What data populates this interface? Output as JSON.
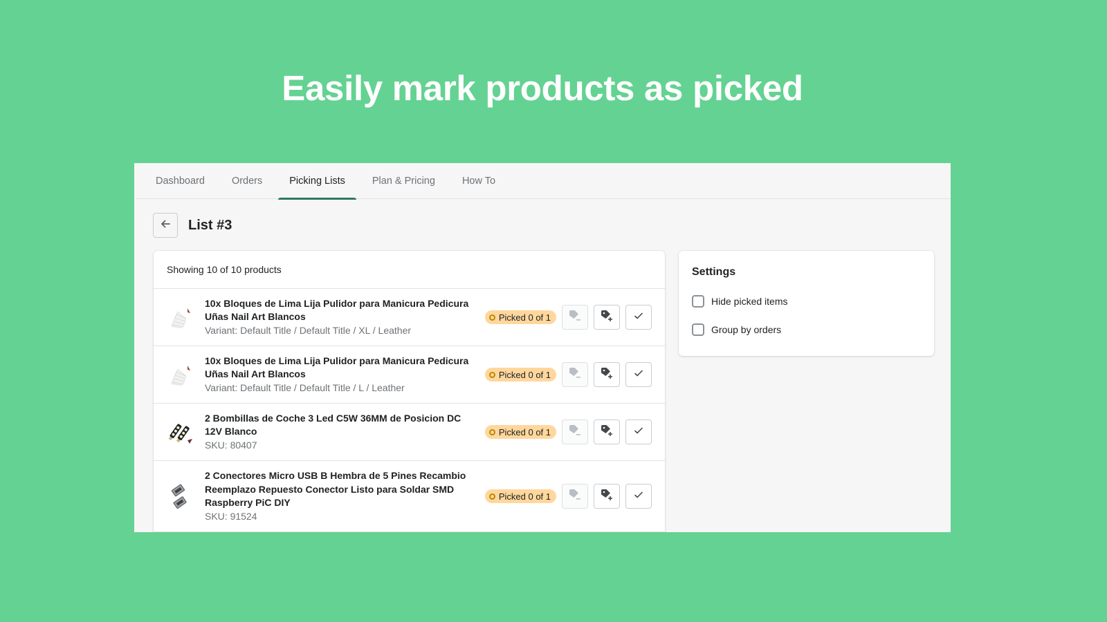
{
  "headline": "Easily mark products as picked",
  "colors": {
    "background": "#64d292",
    "tab_active_indicator": "#2c7a5a",
    "badge_bg": "#ffd79d",
    "badge_dot": "#b98900"
  },
  "tabs": [
    {
      "label": "Dashboard",
      "active": false
    },
    {
      "label": "Orders",
      "active": false
    },
    {
      "label": "Picking Lists",
      "active": true
    },
    {
      "label": "Plan & Pricing",
      "active": false
    },
    {
      "label": "How To",
      "active": false
    }
  ],
  "page": {
    "back_icon": "arrow-left-icon",
    "title": "List #3"
  },
  "products": {
    "summary": "Showing 10 of 10 products",
    "items": [
      {
        "title_line1": "10x Bloques de Lima Lija Pulidor para Manicura Pedicura",
        "title_line2": "Uñas Nail Art Blancos",
        "title_line3": "",
        "subtitle": "Variant: Default Title / Default Title / XL / Leather",
        "status": "Picked 0 of 1",
        "thumb": "nail-file-blocks"
      },
      {
        "title_line1": "10x Bloques de Lima Lija Pulidor para Manicura Pedicura",
        "title_line2": "Uñas Nail Art Blancos",
        "title_line3": "",
        "subtitle": "Variant: Default Title / Default Title / L / Leather",
        "status": "Picked 0 of 1",
        "thumb": "nail-file-blocks"
      },
      {
        "title_line1": "2 Bombillas de Coche 3 Led C5W 36MM de Posicion DC",
        "title_line2": "12V Blanco",
        "title_line3": "",
        "subtitle": "SKU: 80407",
        "status": "Picked 0 of 1",
        "thumb": "led-bulbs"
      },
      {
        "title_line1": "2 Conectores Micro USB B Hembra de 5 Pines Recambio",
        "title_line2": "Reemplazo Repuesto Conector Listo para Soldar SMD",
        "title_line3": "Raspberry PiC DIY",
        "subtitle": "SKU: 91524",
        "status": "Picked 0 of 1",
        "thumb": "usb-connectors"
      }
    ],
    "actions": {
      "remove_tag_icon": "tag-minus-icon",
      "add_tag_icon": "tag-plus-icon",
      "mark_picked_icon": "checkmark-icon"
    }
  },
  "settings": {
    "title": "Settings",
    "options": [
      {
        "label": "Hide picked items",
        "checked": false
      },
      {
        "label": "Group by orders",
        "checked": false
      }
    ]
  }
}
